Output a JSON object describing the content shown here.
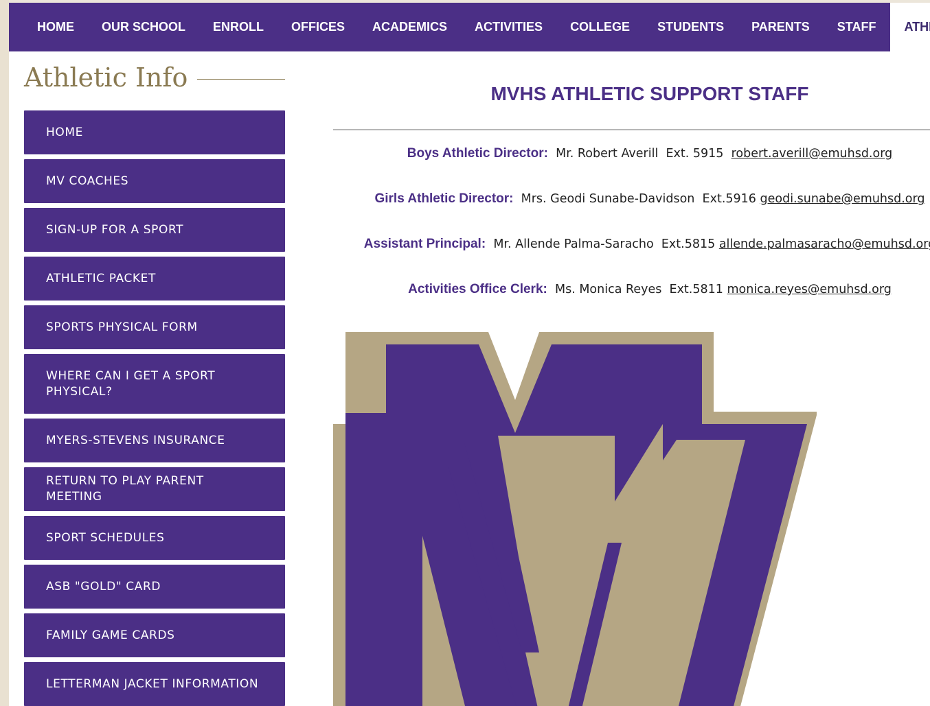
{
  "topnav": {
    "items": [
      {
        "label": "HOME"
      },
      {
        "label": "OUR SCHOOL"
      },
      {
        "label": "ENROLL"
      },
      {
        "label": "OFFICES"
      },
      {
        "label": "ACADEMICS"
      },
      {
        "label": "ACTIVITIES"
      },
      {
        "label": "COLLEGE"
      },
      {
        "label": "STUDENTS"
      },
      {
        "label": "PARENTS"
      },
      {
        "label": "STAFF"
      },
      {
        "label": "ATHLETICS",
        "active": true
      }
    ]
  },
  "sidebar": {
    "title": "Athletic Info",
    "items": [
      {
        "label": "HOME"
      },
      {
        "label": "MV COACHES"
      },
      {
        "label": "SIGN-UP FOR A SPORT"
      },
      {
        "label": "ATHLETIC PACKET"
      },
      {
        "label": "SPORTS PHYSICAL FORM"
      },
      {
        "label": "WHERE CAN I GET A SPORT PHYSICAL?"
      },
      {
        "label": "MYERS-STEVENS INSURANCE"
      },
      {
        "label": "RETURN TO PLAY PARENT MEETING"
      },
      {
        "label": "SPORT SCHEDULES"
      },
      {
        "label": "ASB \"GOLD\" CARD"
      },
      {
        "label": "FAMILY GAME CARDS"
      },
      {
        "label": "LETTERMAN JACKET INFORMATION"
      }
    ]
  },
  "main": {
    "heading": "MVHS ATHLETIC SUPPORT STAFF",
    "staff": [
      {
        "role": "Boys Athletic Director:",
        "name": "Mr. Robert Averill",
        "ext": "Ext. 5915",
        "email": "robert.averill@emuhsd.org"
      },
      {
        "role": "Girls Athletic Director:",
        "name": "Mrs. Geodi Sunabe-Davidson",
        "ext": "Ext.5916",
        "email": "geodi.sunabe@emuhsd.org"
      },
      {
        "role": "Assistant Principal:",
        "name": "Mr. Allende Palma-Saracho",
        "ext": "Ext.5815",
        "email": "allende.palmasaracho@emuhsd.org"
      },
      {
        "role": "Activities Office Clerk:",
        "name": "Ms. Monica Reyes",
        "ext": "Ext.5811",
        "email": "monica.reyes@emuhsd.org"
      }
    ],
    "logo": {
      "icon": "mv-logo-icon",
      "purple": "#4b2f86",
      "gold": "#b5a684"
    }
  },
  "colors": {
    "brand_purple": "#4b2f86",
    "title_gold": "#8a7a52",
    "page_bg": "#e9e1d1"
  }
}
